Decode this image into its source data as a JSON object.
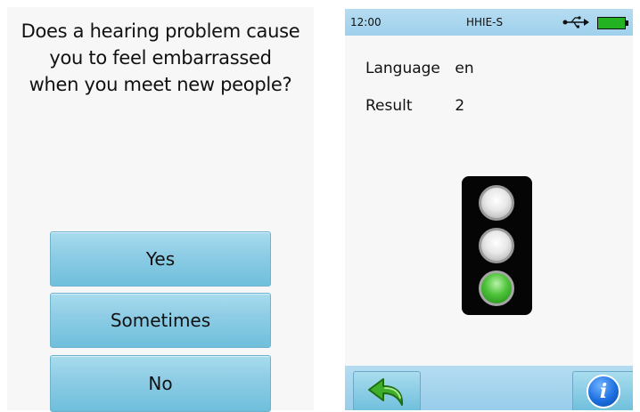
{
  "questionnaire": {
    "question_lines": [
      "Does a hearing problem cause",
      "you to feel embarrassed",
      "when you meet new people?"
    ],
    "answers": [
      "Yes",
      "Sometimes",
      "No"
    ]
  },
  "result_screen": {
    "status_bar": {
      "time": "12:00",
      "title": "HHIE-S",
      "usb_icon": "usb-icon",
      "battery_icon": "battery-icon",
      "battery_color": "#22b222"
    },
    "rows": [
      {
        "label": "Language",
        "value": "en"
      },
      {
        "label": "Result",
        "value": "2"
      }
    ],
    "traffic_light": {
      "active_lamp": "green",
      "lamps": [
        "off",
        "off",
        "green"
      ],
      "green_color": "#3cb82c"
    },
    "bottom_bar": {
      "back_icon": "back-arrow-icon",
      "info_icon": "info-icon",
      "info_glyph": "i"
    }
  }
}
